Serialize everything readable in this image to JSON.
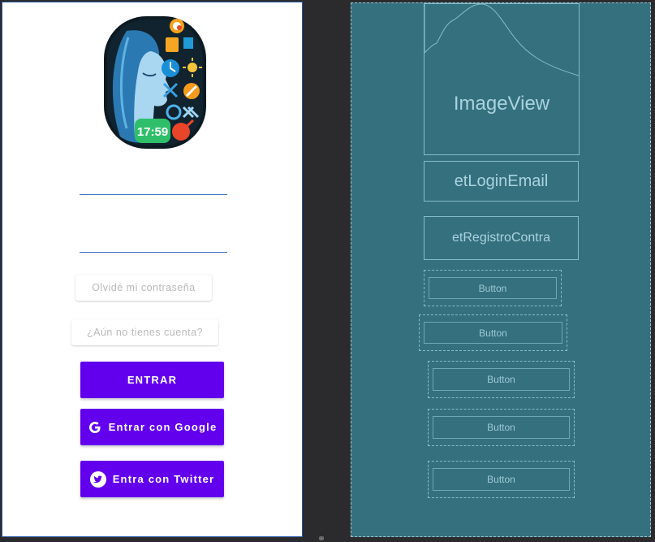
{
  "design": {
    "email_placeholder": "",
    "password_placeholder": "",
    "forgot_password": "Olvidé mi contraseña",
    "no_account": "¿Aún no tienes cuenta?",
    "login_button": "ENTRAR",
    "google_button": "Entrar con Google",
    "twitter_button": "Entra con Twitter",
    "logo_clock_text": "17:59"
  },
  "blueprint": {
    "image_view": "ImageView",
    "email_field": "etLoginEmail",
    "password_field": "etRegistroContra",
    "buttons": [
      "Button",
      "Button",
      "Button",
      "Button",
      "Button"
    ]
  },
  "colors": {
    "primary": "#6200ee",
    "blueprint_bg": "#35707f",
    "underline": "#3b6fc4"
  },
  "icons": [
    "google-g-icon",
    "twitter-bird-icon"
  ]
}
